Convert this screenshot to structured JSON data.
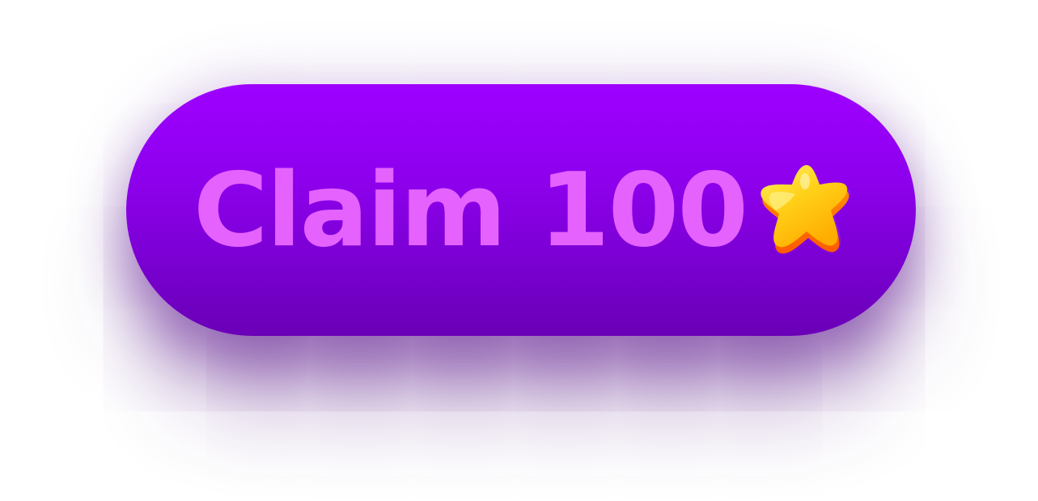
{
  "button": {
    "label": "Claim 100",
    "icon": "star-icon"
  },
  "colors": {
    "button_top": "#9e00ff",
    "button_bottom": "#6a00b6",
    "label_text": "#e562ff",
    "star_yellow": "#ffd21a",
    "star_orange": "#ff7a00"
  }
}
